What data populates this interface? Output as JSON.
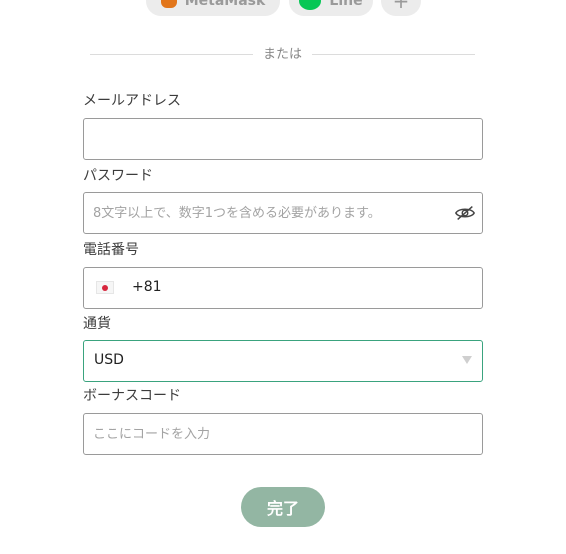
{
  "social": {
    "metamask_label": "MetaMask",
    "line_label": "Line",
    "more_label": "+"
  },
  "divider_text": "または",
  "form": {
    "email": {
      "label": "メールアドレス",
      "value": "",
      "placeholder": ""
    },
    "password": {
      "label": "パスワード",
      "placeholder": "8文字以上で、数字1つを含める必要があります。",
      "icon": "eye-slash-icon"
    },
    "phone": {
      "label": "電話番号",
      "country_flag": "japan-flag-icon",
      "code": "+81"
    },
    "currency": {
      "label": "通貨",
      "selected": "USD"
    },
    "bonus": {
      "label": "ボーナスコード",
      "placeholder": "ここにコードを入力"
    },
    "submit_label": "完了"
  },
  "colors": {
    "accent_border": "#3aa37e",
    "submit_bg": "#93b6a3",
    "line_green": "#06c755",
    "metamask_orange": "#e2761b"
  }
}
